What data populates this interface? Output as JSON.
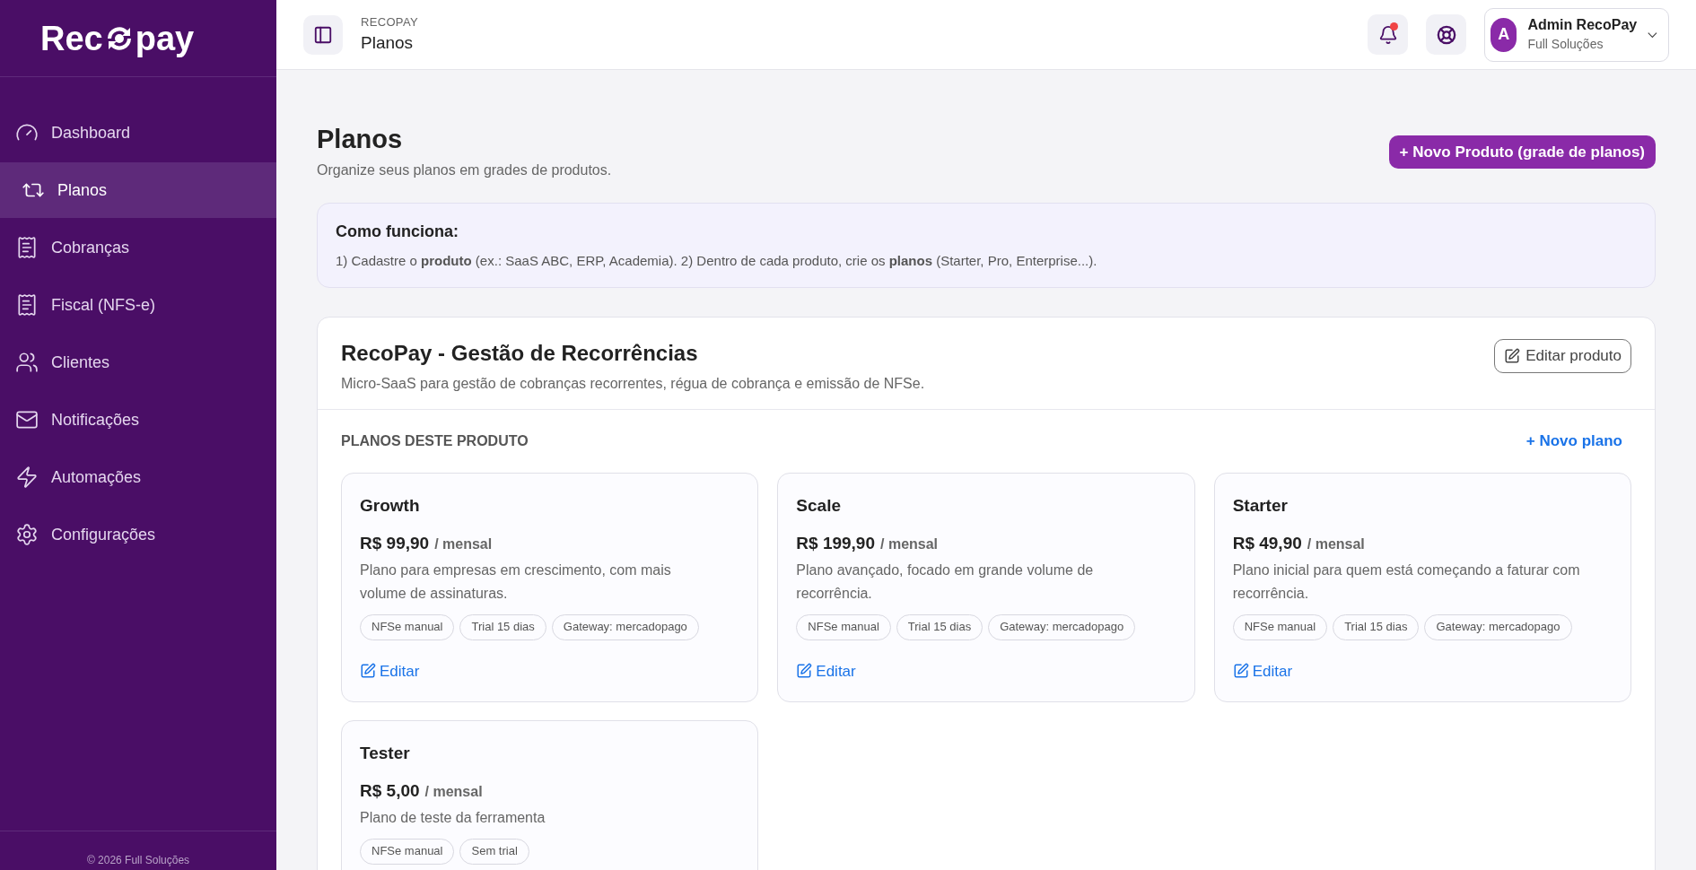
{
  "logo": {
    "before": "Rec",
    "after": "pay"
  },
  "sidebar": {
    "items": [
      {
        "label": "Dashboard",
        "selected": false
      },
      {
        "label": "Planos",
        "selected": true
      },
      {
        "label": "Cobranças",
        "selected": false
      },
      {
        "label": "Fiscal (NFS-e)",
        "selected": false
      },
      {
        "label": "Clientes",
        "selected": false
      },
      {
        "label": "Notificações",
        "selected": false
      },
      {
        "label": "Automações",
        "selected": false
      },
      {
        "label": "Configurações",
        "selected": false
      }
    ],
    "footer": "© 2026 Full Soluções"
  },
  "header": {
    "breadcrumb": "RECOPAY",
    "title": "Planos",
    "notifications_unread": true,
    "user": {
      "initial": "A",
      "name": "Admin RecoPay",
      "company": "Full Soluções"
    }
  },
  "page": {
    "title": "Planos",
    "subtitle": "Organize seus planos em grades de produtos.",
    "new_product_button": "+ Novo Produto (grade de planos)"
  },
  "info": {
    "title": "Como funciona:",
    "text": "1) Cadastre o **produto** (ex.: SaaS ABC, ERP, Academia). 2) Dentro de cada produto, crie os **planos** (Starter, Pro, Enterprise...)."
  },
  "product": {
    "name": "RecoPay - Gestão de Recorrências",
    "description": "Micro-SaaS para gestão de cobranças recorrentes, régua de cobrança e emissão de NFSe.",
    "edit_button": "Editar produto",
    "plans_heading": "PLANOS DESTE PRODUTO",
    "new_plan_button": "+ Novo plano",
    "plans": [
      {
        "name": "Growth",
        "price": "R$ 99,90",
        "period": "/ mensal",
        "description": "Plano para empresas em crescimento, com mais volume de assinaturas.",
        "tags": [
          "NFSe manual",
          "Trial 15 dias",
          "Gateway: mercadopago"
        ],
        "edit": "Editar"
      },
      {
        "name": "Scale",
        "price": "R$ 199,90",
        "period": "/ mensal",
        "description": "Plano avançado, focado em grande volume de recorrência.",
        "tags": [
          "NFSe manual",
          "Trial 15 dias",
          "Gateway: mercadopago"
        ],
        "edit": "Editar"
      },
      {
        "name": "Starter",
        "price": "R$ 49,90",
        "period": "/ mensal",
        "description": "Plano inicial para quem está começando a faturar com recorrência.",
        "tags": [
          "NFSe manual",
          "Trial 15 dias",
          "Gateway: mercadopago"
        ],
        "edit": "Editar"
      },
      {
        "name": "Tester",
        "price": "R$ 5,00",
        "period": "/ mensal",
        "description": "Plano de teste da ferramenta",
        "tags": [
          "NFSe manual",
          "Sem trial"
        ]
      }
    ]
  }
}
